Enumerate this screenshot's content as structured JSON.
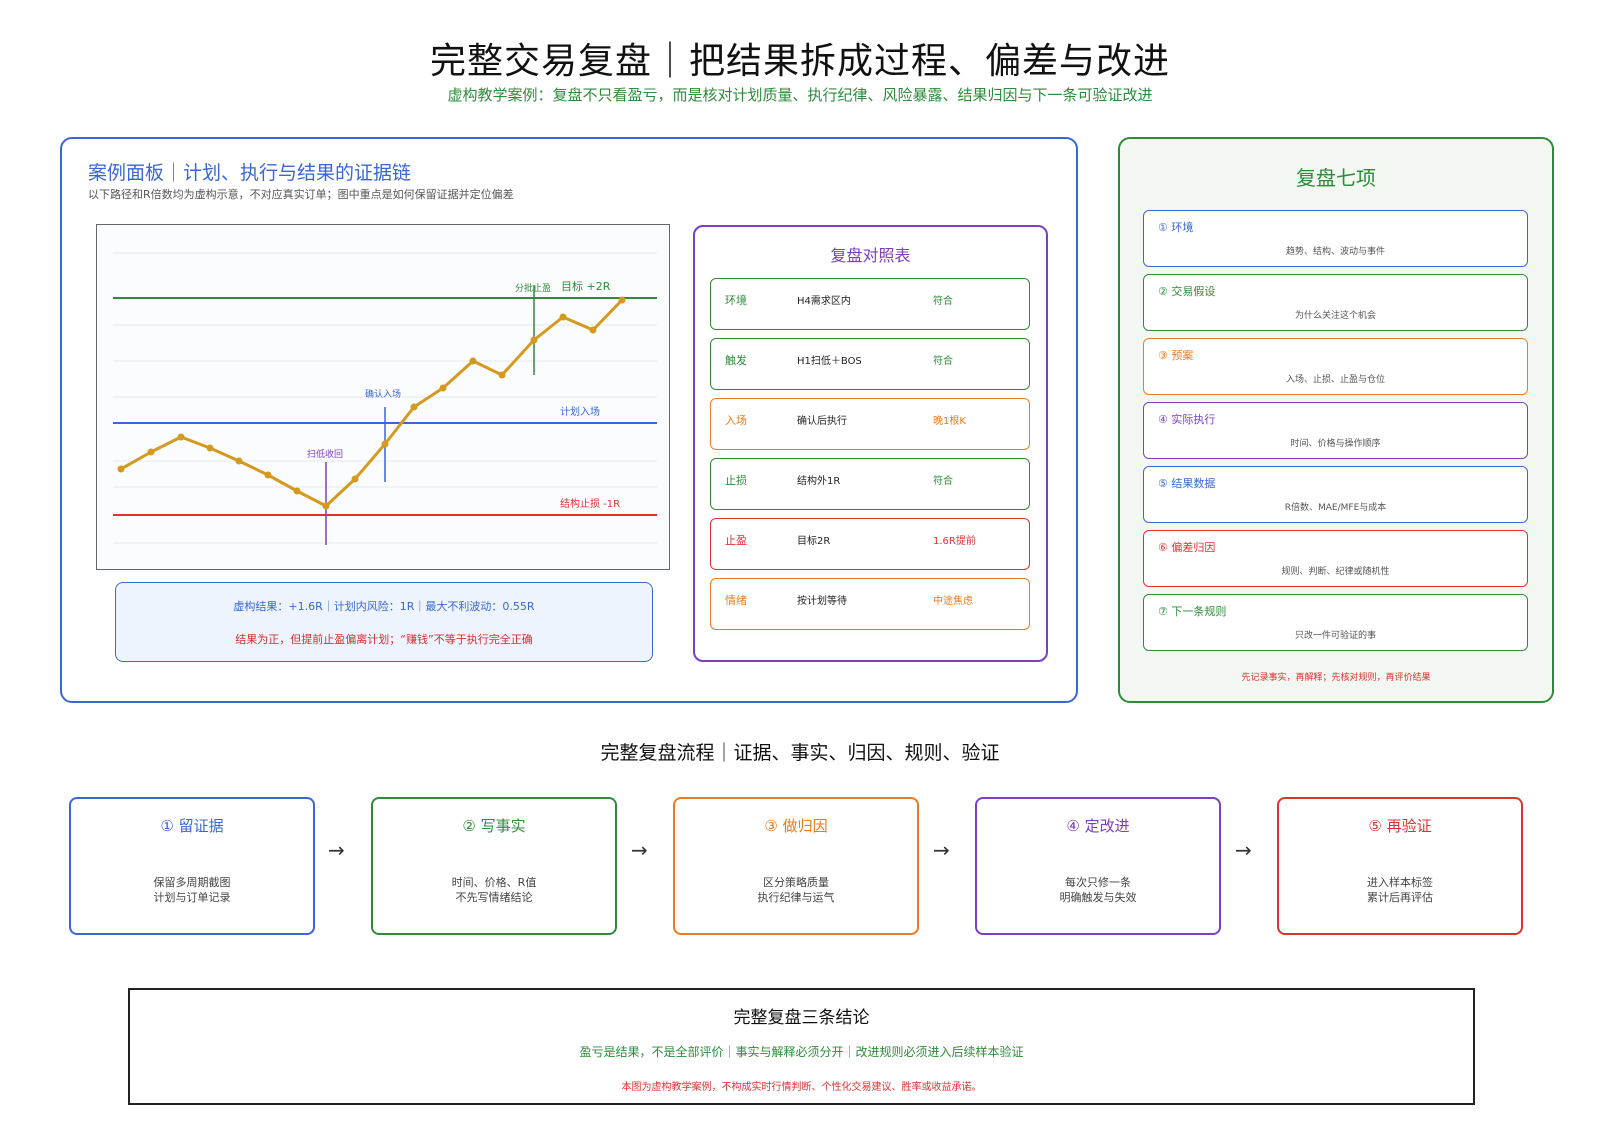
{
  "header": {
    "title": "完整交易复盘｜把结果拆成过程、偏差与改进",
    "subtitle": "虚构教学案例：复盘不只看盈亏，而是核对计划质量、执行纪律、风险暴露、结果归因与下一条可验证改进"
  },
  "case_panel": {
    "title": "案例面板｜计划、执行与结果的证据链",
    "subtitle": "以下路径和R倍数均为虚构示意，不对应真实订单；图中重点是如何保留证据并定位偏差",
    "chart": {
      "labels": {
        "target": "目标 +2R",
        "partial_tp": "分批止盈",
        "plan_entry": "计划入场",
        "confirm_entry": "确认入场",
        "sweep": "扫低收回",
        "stop": "结构止损 -1R"
      },
      "colors": {
        "target": "#2e8b3a",
        "entry": "#3a66d6",
        "stop": "#e03131",
        "path": "#d49a1f",
        "marker": "#7b3fc4"
      }
    },
    "result": {
      "line1": "虚构结果：+1.6R｜计划内风险：1R｜最大不利波动：0.55R",
      "line2": "结果为正，但提前止盈偏离计划；“赚钱”不等于执行完全正确"
    }
  },
  "compare_panel": {
    "title": "复盘对照表",
    "rows": [
      {
        "item": "环境",
        "detail": "H4需求区内",
        "verdict": "符合",
        "tone": "green"
      },
      {
        "item": "触发",
        "detail": "H1扫低＋BOS",
        "verdict": "符合",
        "tone": "green"
      },
      {
        "item": "入场",
        "detail": "确认后执行",
        "verdict": "晚1根K",
        "tone": "orange"
      },
      {
        "item": "止损",
        "detail": "结构外1R",
        "verdict": "符合",
        "tone": "green"
      },
      {
        "item": "止盈",
        "detail": "目标2R",
        "verdict": "1.6R提前",
        "tone": "red"
      },
      {
        "item": "情绪",
        "detail": "按计划等待",
        "verdict": "中途焦虑",
        "tone": "orange"
      }
    ]
  },
  "seven_panel": {
    "title": "复盘七项",
    "items": [
      {
        "title": "① 环境",
        "desc": "趋势、结构、波动与事件",
        "tone": "blue"
      },
      {
        "title": "② 交易假设",
        "desc": "为什么关注这个机会",
        "tone": "green"
      },
      {
        "title": "③ 预案",
        "desc": "入场、止损、止盈与仓位",
        "tone": "orange"
      },
      {
        "title": "④ 实际执行",
        "desc": "时间、价格与操作顺序",
        "tone": "purple"
      },
      {
        "title": "⑤ 结果数据",
        "desc": "R倍数、MAE/MFE与成本",
        "tone": "blue"
      },
      {
        "title": "⑥ 偏差归因",
        "desc": "规则、判断、纪律或随机性",
        "tone": "red"
      },
      {
        "title": "⑦ 下一条规则",
        "desc": "只改一件可验证的事",
        "tone": "green"
      }
    ],
    "note": "先记录事实，再解释；先核对规则，再评价结果"
  },
  "flow": {
    "title": "完整复盘流程｜证据、事实、归因、规则、验证",
    "steps": [
      {
        "title": "① 留证据",
        "line1": "保留多周期截图",
        "line2": "计划与订单记录",
        "tone": "blue"
      },
      {
        "title": "② 写事实",
        "line1": "时间、价格、R值",
        "line2": "不先写情绪结论",
        "tone": "green"
      },
      {
        "title": "③ 做归因",
        "line1": "区分策略质量",
        "line2": "执行纪律与运气",
        "tone": "orange"
      },
      {
        "title": "④ 定改进",
        "line1": "每次只修一条",
        "line2": "明确触发与失效",
        "tone": "purple"
      },
      {
        "title": "⑤ 再验证",
        "line1": "进入样本标签",
        "line2": "累计后再评估",
        "tone": "red"
      }
    ],
    "arrow": "→"
  },
  "conclusion": {
    "title": "完整复盘三条结论",
    "line1": "盈亏是结果，不是全部评价｜事实与解释必须分开｜改进规则必须进入后续样本验证",
    "line2": "本图为虚构教学案例，不构成实时行情判断、个性化交易建议、胜率或收益承诺。"
  },
  "palette": {
    "blue": "#3a66d6",
    "green": "#2e8b3a",
    "orange": "#ef7a1a",
    "purple": "#7b3fc4",
    "red": "#e03131"
  }
}
